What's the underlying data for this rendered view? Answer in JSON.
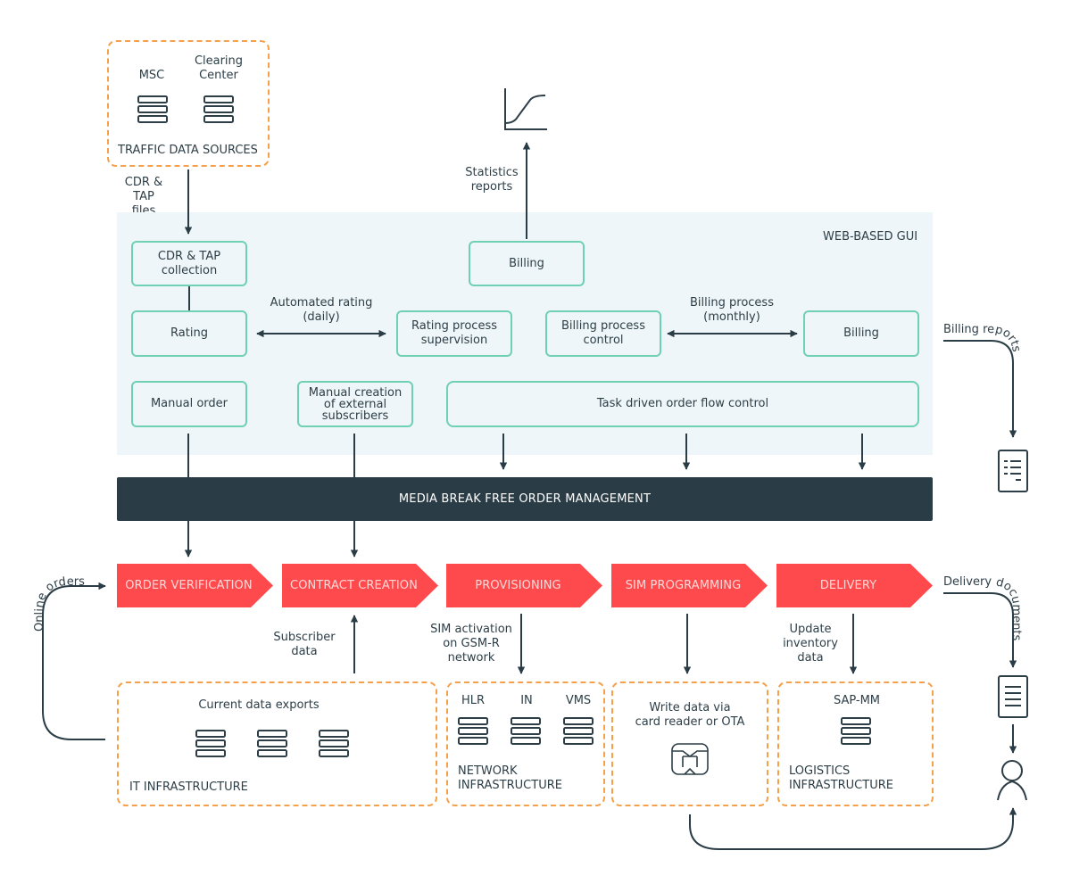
{
  "traffic_sources": {
    "title": "TRAFFIC DATA SOURCES",
    "items": [
      {
        "label": "MSC",
        "icon": "server-icon"
      },
      {
        "label": "Clearing Center",
        "label_lines": [
          "Clearing",
          "Center"
        ],
        "icon": "server-icon"
      }
    ]
  },
  "labels": {
    "cdr_tap_files": [
      "CDR & TAP",
      "files"
    ],
    "statistics_reports": [
      "Statistics",
      "reports"
    ],
    "automated_rating": [
      "Automated rating",
      "(daily)"
    ],
    "billing_process": [
      "Billing process",
      "(monthly)"
    ],
    "billing_reports": "Billing reports",
    "online_orders": "Online orders",
    "delivery_documents": "Delivery documents",
    "subscriber_data": [
      "Subscriber",
      "data"
    ],
    "sim_activation": [
      "SIM activation",
      "on GSM-R",
      "network"
    ],
    "update_inventory": [
      "Update",
      "inventory",
      "data"
    ]
  },
  "gui": {
    "title": "WEB-BASED GUI",
    "boxes": {
      "cdr_tap_collection": [
        "CDR & TAP",
        "collection"
      ],
      "rating": "Rating",
      "billing_top": "Billing",
      "rating_supervision": [
        "Rating process",
        "supervision"
      ],
      "billing_control": [
        "Billing process",
        "control"
      ],
      "billing_right": "Billing",
      "manual_order": "Manual order",
      "manual_creation": [
        "Manual creation",
        "of external",
        "subscribers"
      ],
      "task_flow": "Task driven order flow control"
    }
  },
  "management_bar": "MEDIA BREAK FREE ORDER MANAGEMENT",
  "pipeline": {
    "color": "#ff4a4d",
    "stages": [
      "ORDER VERIFICATION",
      "CONTRACT CREATION",
      "PROVISIONING",
      "SIM PROGRAMMING",
      "DELIVERY"
    ]
  },
  "infrastructure": {
    "it": {
      "title": "IT INFRASTRUCTURE",
      "caption": "Current data exports",
      "server_count": 3
    },
    "network": {
      "title_lines": [
        "NETWORK",
        "INFRASTRUCTURE"
      ],
      "items": [
        "HLR",
        "IN",
        "VMS"
      ]
    },
    "sim": {
      "caption_lines": [
        "Write data via",
        "card reader or OTA"
      ],
      "icon": "sim-chip-icon"
    },
    "logistics": {
      "title_lines": [
        "LOGISTICS",
        "INFRASTRUCTURE"
      ],
      "items": [
        "SAP-MM"
      ]
    }
  },
  "icons": {
    "statistics": "line-chart-icon",
    "billing_report_doc": "report-document-icon",
    "delivery_doc": "document-icon",
    "customer": "person-icon"
  },
  "colors": {
    "accent_red": "#ff4a4d",
    "dashed_orange": "#f5a04a",
    "box_green": "#6fd0b2",
    "dark": "#2a3c46",
    "panel_bg": "#eef6f9"
  }
}
